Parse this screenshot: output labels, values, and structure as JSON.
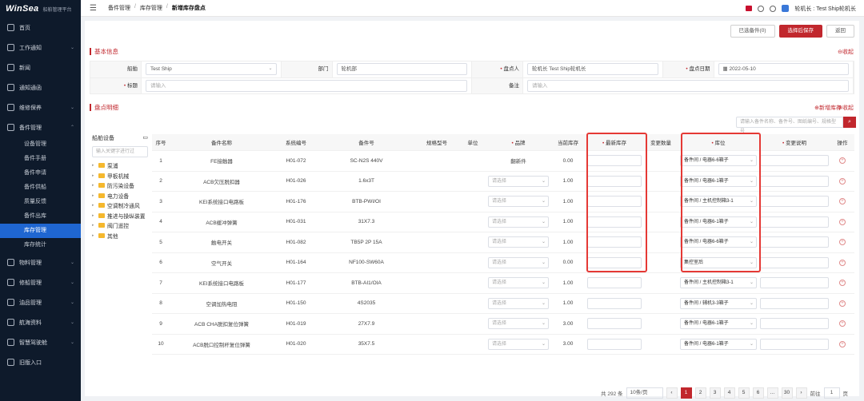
{
  "app": {
    "brand": "WinSea",
    "subtitle": "船舶管理平台"
  },
  "sidebar": {
    "items": [
      {
        "label": "首页",
        "icon": "home-icon"
      },
      {
        "label": "工作通知",
        "icon": "notice-icon",
        "chevron": "⌄"
      },
      {
        "label": "新闻",
        "icon": "news-icon"
      },
      {
        "label": "通知通函",
        "icon": "circular-icon"
      },
      {
        "label": "维修保养",
        "icon": "maintenance-icon",
        "chevron": "⌄"
      },
      {
        "label": "备件管理",
        "icon": "spare-parts-icon",
        "chevron": "⌃"
      }
    ],
    "sub_items": [
      "设备管理",
      "备件手册",
      "备件申请",
      "备件供船",
      "质量反馈",
      "备件出库",
      "库存管理",
      "库存统计"
    ],
    "active_sub": "库存管理",
    "bottom_items": [
      {
        "label": "物料管理",
        "icon": "material-icon",
        "chevron": "⌄"
      },
      {
        "label": "修船管理",
        "icon": "repair-icon",
        "chevron": "⌄"
      },
      {
        "label": "油品管理",
        "icon": "oil-icon",
        "chevron": "⌄"
      },
      {
        "label": "航海资料",
        "icon": "nautical-icon",
        "chevron": "⌄"
      },
      {
        "label": "智慧驾驶舱",
        "icon": "cockpit-icon",
        "chevron": "⌄"
      },
      {
        "label": "旧版入口",
        "icon": "legacy-icon"
      }
    ]
  },
  "topbar": {
    "breadcrumb": [
      "备件管理",
      "库存管理",
      "新增库存盘点"
    ],
    "separator": "/",
    "user": "轮机长 : Test Ship轮机长"
  },
  "actions": {
    "selected": "已选备件(0)",
    "save": "选择后保存",
    "back": "返回"
  },
  "basic": {
    "title": "基本信息",
    "collapse": "⊖收起",
    "ship_label": "船舶",
    "ship_value": "Test Ship",
    "dept_label": "部门",
    "dept_value": "轮机部",
    "counter_label": "盘点人",
    "counter_value": "轮机长 Test Ship轮机长",
    "date_label": "盘点日期",
    "date_value": "2022-05-10",
    "title_label": "标题",
    "title_placeholder": "请输入",
    "remark_label": "备注",
    "remark_placeholder": "请输入"
  },
  "detail": {
    "title": "盘点明细",
    "new_link": "⊕新增库存",
    "collapse": "⊖收起",
    "search_placeholder": "请输入备件名称、备件号、图纸编号、规格型号",
    "tree_title": "船舶设备",
    "tree_search": "输入关键字进行过",
    "tree": [
      "泵浦",
      "甲板机械",
      "防污染设备",
      "电力设备",
      "空调制冷通风",
      "推进与操纵装置",
      "阀门遥控",
      "其他"
    ]
  },
  "table": {
    "headers": {
      "idx": "序号",
      "name": "备件名称",
      "sys": "系统编号",
      "part": "备件号",
      "spec": "规格型号",
      "unit": "单位",
      "brand": "品牌",
      "stock": "当前库存",
      "newstock": "最新库存",
      "change": "变更数量",
      "loc": "库位",
      "desc": "变更说明",
      "op": "操作"
    },
    "required_mark": "•",
    "placeholder": "请选择",
    "rows": [
      {
        "idx": "1",
        "name": "FE接触器",
        "sys": "H01-072",
        "part": "SC-N2S 440V",
        "brand": "翻新件",
        "stock": "0.00",
        "loc": "备件间 / 电器6-6箱子"
      },
      {
        "idx": "2",
        "name": "ACB欠压脱扣器",
        "sys": "H01-026",
        "part": "1.6x3T",
        "brand": "",
        "stock": "1.00",
        "loc": "备件间 / 电器6-1箱子"
      },
      {
        "idx": "3",
        "name": "KEI系统接口电路板",
        "sys": "H01-176",
        "part": "BTB-PWI/OI",
        "brand": "",
        "stock": "1.00",
        "loc": "备件间 / 主机控制箱3-1"
      },
      {
        "idx": "4",
        "name": "ACB缓冲弹簧",
        "sys": "H01-031",
        "part": "31X7.3",
        "brand": "",
        "stock": "1.00",
        "loc": "备件间 / 电器6-1箱子"
      },
      {
        "idx": "5",
        "name": "触电开关",
        "sys": "H01-082",
        "part": "TB5P 2P 15A",
        "brand": "",
        "stock": "1.00",
        "loc": "备件间 / 电器6-6箱子"
      },
      {
        "idx": "6",
        "name": "空气开关",
        "sys": "H01-164",
        "part": "NF100-SW60A",
        "brand": "",
        "stock": "0.00",
        "loc": "集控室后"
      },
      {
        "idx": "7",
        "name": "KEI系统接口电路板",
        "sys": "H01-177",
        "part": "BTB-AI1/OIA",
        "brand": "",
        "stock": "1.00",
        "loc": "备件间 / 主机控制箱3-1"
      },
      {
        "idx": "8",
        "name": "空调加热电阻",
        "sys": "H01-150",
        "part": "4S2035",
        "brand": "",
        "stock": "1.00",
        "loc": "备件间 / 辅机3-3箱子"
      },
      {
        "idx": "9",
        "name": "ACB CHA脱扣复位弹簧",
        "sys": "H01-019",
        "part": "27X7.9",
        "brand": "",
        "stock": "3.00",
        "loc": "备件间 / 电器6-1箱子"
      },
      {
        "idx": "10",
        "name": "ACB脱口控制杆复位弹簧",
        "sys": "H01-020",
        "part": "35X7.5",
        "brand": "",
        "stock": "3.00",
        "loc": "备件间 / 电器6-1箱子"
      }
    ]
  },
  "pager": {
    "total": "共 292 条",
    "size": "10条/页",
    "prev": "‹",
    "next": "›",
    "pages": [
      "1",
      "2",
      "3",
      "4",
      "5",
      "6",
      "…",
      "30"
    ],
    "active": "1",
    "goto_label": "前往",
    "goto_value": "1",
    "goto_suffix": "页"
  },
  "colors": {
    "accent": "#c1272d",
    "sidebar": "#0e1a2b",
    "active": "#1f66d1",
    "highlight": "#e53935"
  }
}
